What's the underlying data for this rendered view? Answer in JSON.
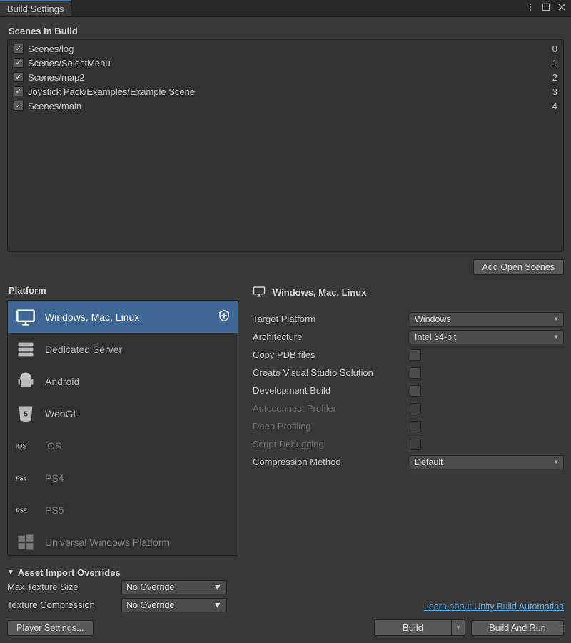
{
  "window": {
    "title": "Build Settings"
  },
  "scenes": {
    "title": "Scenes In Build",
    "items": [
      {
        "path": "Scenes/log",
        "index": 0,
        "checked": true
      },
      {
        "path": "Scenes/SelectMenu",
        "index": 1,
        "checked": true
      },
      {
        "path": "Scenes/map2",
        "index": 2,
        "checked": true
      },
      {
        "path": "Joystick Pack/Examples/Example Scene",
        "index": 3,
        "checked": true
      },
      {
        "path": "Scenes/main",
        "index": 4,
        "checked": true
      }
    ],
    "addOpen": "Add Open Scenes"
  },
  "platform": {
    "title": "Platform",
    "items": [
      {
        "label": "Windows, Mac, Linux",
        "selected": true,
        "icon": "monitor"
      },
      {
        "label": "Dedicated Server",
        "icon": "server"
      },
      {
        "label": "Android",
        "icon": "android"
      },
      {
        "label": "WebGL",
        "icon": "html5"
      },
      {
        "label": "iOS",
        "icon": "ios",
        "dimmed": true
      },
      {
        "label": "PS4",
        "icon": "ps4",
        "dimmed": true
      },
      {
        "label": "PS5",
        "icon": "ps5",
        "dimmed": true
      },
      {
        "label": "Universal Windows Platform",
        "icon": "uwp",
        "dimmed": true
      }
    ]
  },
  "details": {
    "heading": "Windows, Mac, Linux",
    "rows": {
      "targetPlatform": {
        "label": "Target Platform",
        "value": "Windows"
      },
      "architecture": {
        "label": "Architecture",
        "value": "Intel 64-bit"
      },
      "copyPDB": {
        "label": "Copy PDB files",
        "checked": false
      },
      "createVS": {
        "label": "Create Visual Studio Solution",
        "checked": false
      },
      "devBuild": {
        "label": "Development Build",
        "checked": false
      },
      "autoConnect": {
        "label": "Autoconnect Profiler",
        "checked": false,
        "disabled": true
      },
      "deepProfile": {
        "label": "Deep Profiling",
        "checked": false,
        "disabled": true
      },
      "scriptDebug": {
        "label": "Script Debugging",
        "checked": false,
        "disabled": true
      },
      "compression": {
        "label": "Compression Method",
        "value": "Default"
      }
    }
  },
  "overrides": {
    "title": "Asset Import Overrides",
    "maxTexture": {
      "label": "Max Texture Size",
      "value": "No Override"
    },
    "texComp": {
      "label": "Texture Compression",
      "value": "No Override"
    }
  },
  "footer": {
    "link": "Learn about Unity Build Automation",
    "playerSettings": "Player Settings...",
    "build": "Build",
    "buildAndRun": "Build And Run"
  },
  "watermark": "CSDN @u宅"
}
